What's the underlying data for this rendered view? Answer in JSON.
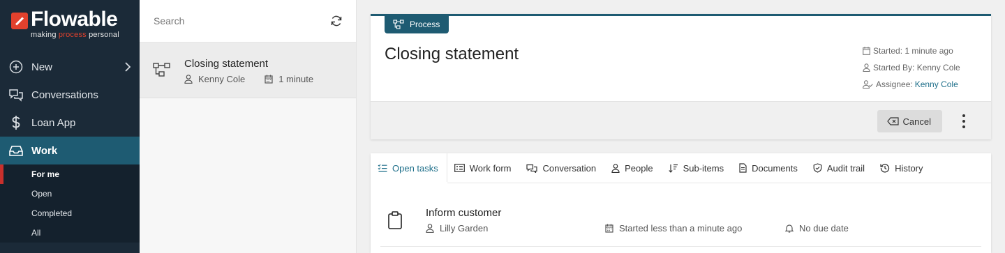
{
  "brand": {
    "name": "Flowable",
    "tagline_pre": "making ",
    "tagline_accent": "process",
    "tagline_post": " personal",
    "accent_color": "#e2412d"
  },
  "sidebar": {
    "items": [
      {
        "label": "New",
        "icon": "plus-circle-icon"
      },
      {
        "label": "Conversations",
        "icon": "chat-icon"
      },
      {
        "label": "Loan App",
        "icon": "dollar-icon"
      },
      {
        "label": "Work",
        "icon": "inbox-icon"
      }
    ],
    "sub_items": [
      {
        "label": "For me"
      },
      {
        "label": "Open"
      },
      {
        "label": "Completed"
      },
      {
        "label": "All"
      }
    ]
  },
  "list": {
    "search_placeholder": "Search",
    "items": [
      {
        "title": "Closing statement",
        "person": "Kenny Cole",
        "time": "1 minute"
      }
    ]
  },
  "case": {
    "badge": "Process",
    "title": "Closing statement",
    "started": "Started: 1 minute ago",
    "started_by": "Started By: Kenny Cole",
    "assignee_label": "Assignee:",
    "assignee": "Kenny Cole",
    "cancel_label": "Cancel"
  },
  "tabs": [
    {
      "label": "Open tasks",
      "icon": "task-list-icon"
    },
    {
      "label": "Work form",
      "icon": "form-icon"
    },
    {
      "label": "Conversation",
      "icon": "chat-icon"
    },
    {
      "label": "People",
      "icon": "person-icon"
    },
    {
      "label": "Sub-items",
      "icon": "sort-icon"
    },
    {
      "label": "Documents",
      "icon": "document-icon"
    },
    {
      "label": "Audit trail",
      "icon": "shield-icon"
    },
    {
      "label": "History",
      "icon": "history-icon"
    }
  ],
  "task": {
    "title": "Inform customer",
    "person": "Lilly Garden",
    "started": "Started less than a minute ago",
    "due": "No due date"
  },
  "colors": {
    "sidebar_bg": "#1b2a38",
    "primary": "#1e5b72",
    "link": "#1e6f8a",
    "active_marker": "#c9302c"
  }
}
